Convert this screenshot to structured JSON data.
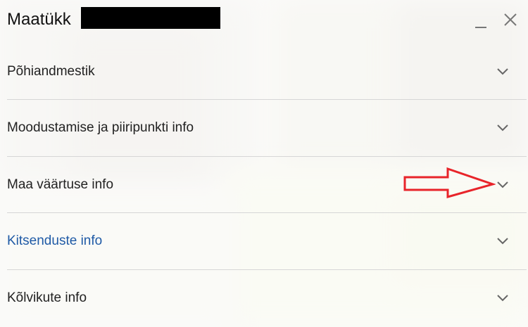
{
  "header": {
    "title": "Maatükk",
    "minimize_icon": "minimize-icon",
    "close_icon": "close-icon"
  },
  "sections": [
    {
      "label": "Põhiandmestik",
      "icon": "chevron-down-icon"
    },
    {
      "label": "Moodustamise ja piiripunkti info",
      "icon": "chevron-down-icon"
    },
    {
      "label": "Maa väärtuse info",
      "icon": "chevron-down-icon"
    },
    {
      "label": "Kitsenduste info",
      "icon": "chevron-down-icon",
      "color": "#1f5aa6"
    },
    {
      "label": "Kõlvikute info",
      "icon": "chevron-down-icon"
    }
  ],
  "annotation": {
    "color": "#e8242a",
    "points_to": "Maa väärtuse info"
  }
}
